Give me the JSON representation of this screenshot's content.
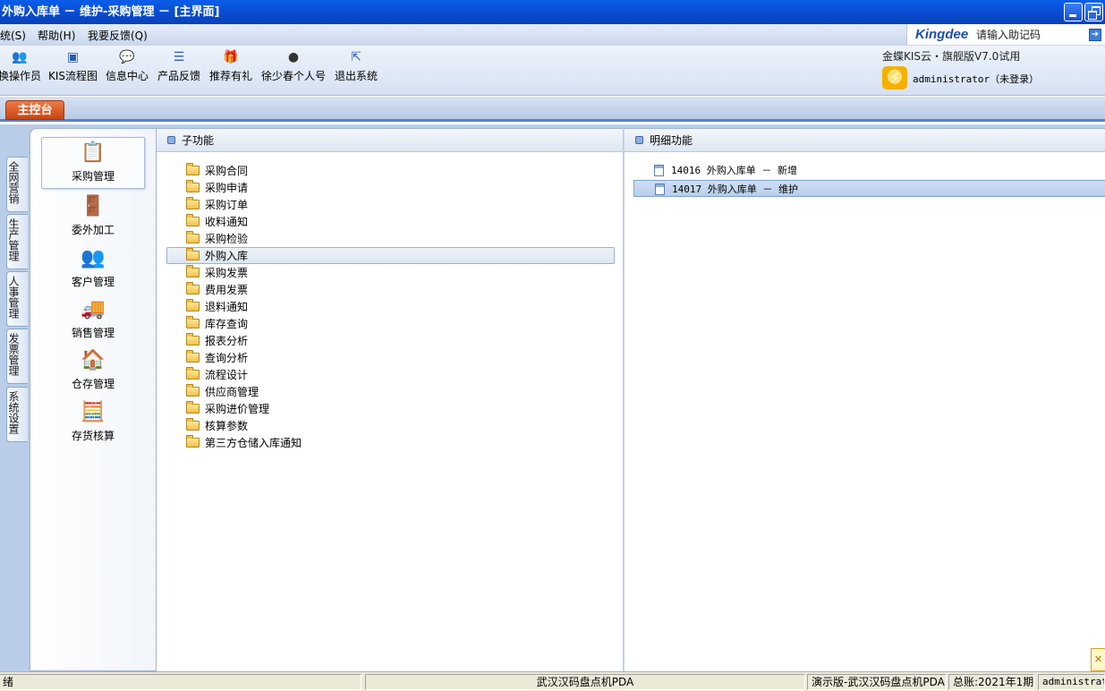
{
  "window": {
    "title": "外购入库单 － 维护-采购管理 － [主界面]"
  },
  "menubar": {
    "items": [
      "统(S)",
      "帮助(H)",
      "我要反馈(Q)"
    ],
    "brand": "Kingdee",
    "help_code_placeholder": "请输入助记码"
  },
  "toolbar": {
    "items": [
      {
        "label": "换操作员",
        "icon": "switch-user-icon"
      },
      {
        "label": "KIS流程图",
        "icon": "flowchart-icon"
      },
      {
        "label": "信息中心",
        "icon": "message-icon"
      },
      {
        "label": "产品反馈",
        "icon": "feedback-icon"
      },
      {
        "label": "推荐有礼",
        "icon": "gift-icon"
      },
      {
        "label": "徐少春个人号",
        "icon": "avatar-icon"
      },
      {
        "label": "退出系统",
        "icon": "exit-icon"
      }
    ],
    "product_name": "金蝶KIS云・旗舰版V7.0试用",
    "user_status": "administrator（未登录）"
  },
  "tabs": {
    "main": "主控台"
  },
  "side_tabs": [
    "全网营销",
    "生产管理",
    "人事管理",
    "发票管理",
    "系统设置"
  ],
  "modules": [
    {
      "label": "采购管理",
      "icon": "purchase-icon",
      "active": true
    },
    {
      "label": "委外加工",
      "icon": "outsource-icon",
      "active": false
    },
    {
      "label": "客户管理",
      "icon": "customer-icon",
      "active": false
    },
    {
      "label": "销售管理",
      "icon": "sales-truck-icon",
      "active": false
    },
    {
      "label": "仓存管理",
      "icon": "warehouse-icon",
      "active": false
    },
    {
      "label": "存货核算",
      "icon": "inventory-accounting-icon",
      "active": false
    }
  ],
  "sub_panel": {
    "header": "子功能",
    "selected_index": 5,
    "items": [
      "采购合同",
      "采购申请",
      "采购订单",
      "收料通知",
      "采购检验",
      "外购入库",
      "采购发票",
      "费用发票",
      "退料通知",
      "库存查询",
      "报表分析",
      "查询分析",
      "流程设计",
      "供应商管理",
      "采购进价管理",
      "核算参数",
      "第三方仓储入库通知"
    ]
  },
  "detail_panel": {
    "header": "明细功能",
    "selected_index": 1,
    "items": [
      "14016  外购入库单 － 新增",
      "14017  外购入库单 － 维护"
    ]
  },
  "statusbar": {
    "ready": "绪",
    "company": "武汉汉码盘点机PDA",
    "version": "演示版-武汉汉码盘点机PDA",
    "period": "总账:2021年1期",
    "user": "administrator"
  },
  "colors": {
    "title_bar": "#0a4fd6",
    "main_tab": "#e0622a",
    "workspace": "#b9cde9"
  }
}
